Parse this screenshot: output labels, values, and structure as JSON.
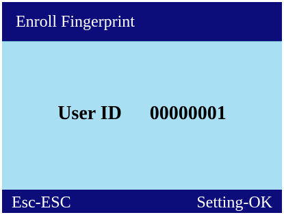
{
  "title": "Enroll Fingerprint",
  "content": {
    "user_id_label": "User ID",
    "user_id_value": "00000001"
  },
  "footer": {
    "left_key": "Esc-ESC",
    "right_key": "Setting-OK"
  },
  "colors": {
    "header_footer": "#0c0c7a",
    "content_background": "#a9dff3",
    "header_text": "#ffffff",
    "content_text": "#000000"
  }
}
